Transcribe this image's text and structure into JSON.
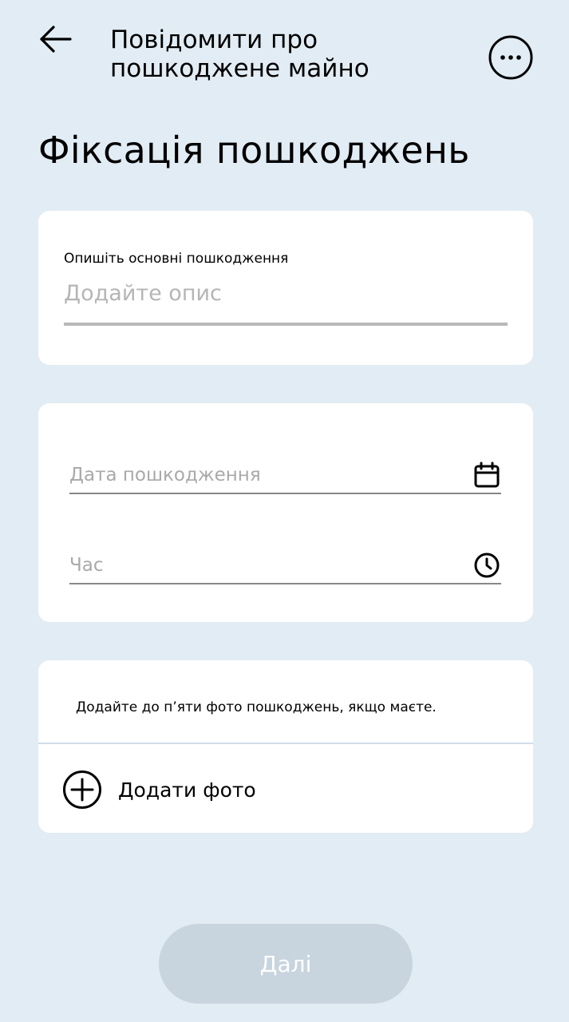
{
  "header": {
    "title": "Повідомити про пошкоджене майно",
    "back_icon": "arrow-left-icon",
    "menu_icon": "more-horizontal-icon"
  },
  "page_title": "Фіксація пошкоджень",
  "description": {
    "label": "Опишіть основні пошкодження",
    "placeholder": "Додайте опис",
    "value": ""
  },
  "datetime": {
    "date_placeholder": "Дата пошкодження",
    "date_icon": "calendar-icon",
    "time_placeholder": "Час",
    "time_icon": "clock-icon"
  },
  "photos": {
    "note": "Додайте до п’яти фото пошкоджень, якщо маєте.",
    "add_label": "Додати фото",
    "add_icon": "plus-circle-icon"
  },
  "footer": {
    "next_label": "Далі"
  },
  "colors": {
    "background": "#e2ecf4",
    "card": "#ffffff",
    "button_disabled": "#c8d4de",
    "placeholder": "#b5b5b5"
  }
}
